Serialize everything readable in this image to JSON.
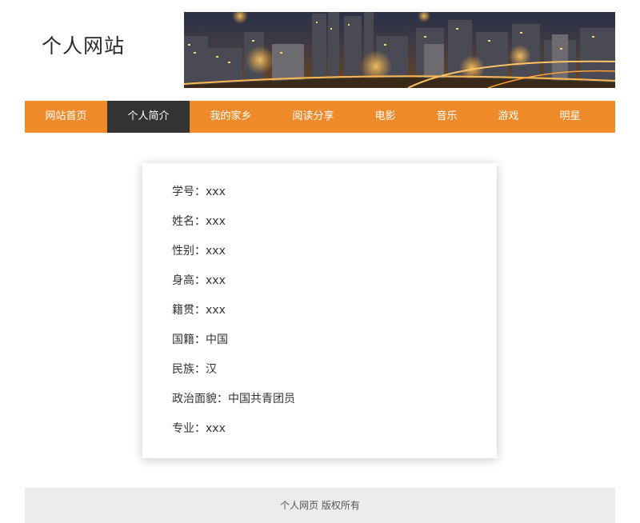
{
  "header": {
    "site_title": "个人网站"
  },
  "nav": {
    "items": [
      {
        "label": "网站首页"
      },
      {
        "label": "个人简介"
      },
      {
        "label": "我的家乡"
      },
      {
        "label": "阅读分享"
      },
      {
        "label": "电影"
      },
      {
        "label": "音乐"
      },
      {
        "label": "游戏"
      },
      {
        "label": "明星"
      }
    ],
    "active_label": "个人简介"
  },
  "profile": {
    "rows": [
      "学号：xxx",
      "姓名：xxx",
      "性别：xxx",
      "身高：xxx",
      "籍贯：xxx",
      "国籍：中国",
      "民族：汉",
      "政治面貌：中国共青团员",
      "专业：xxx"
    ]
  },
  "footer": {
    "text": "个人网页 版权所有"
  },
  "colors": {
    "nav_bg": "#ee8a2a",
    "nav_active_bg": "#333333",
    "footer_bg": "#ececec"
  }
}
